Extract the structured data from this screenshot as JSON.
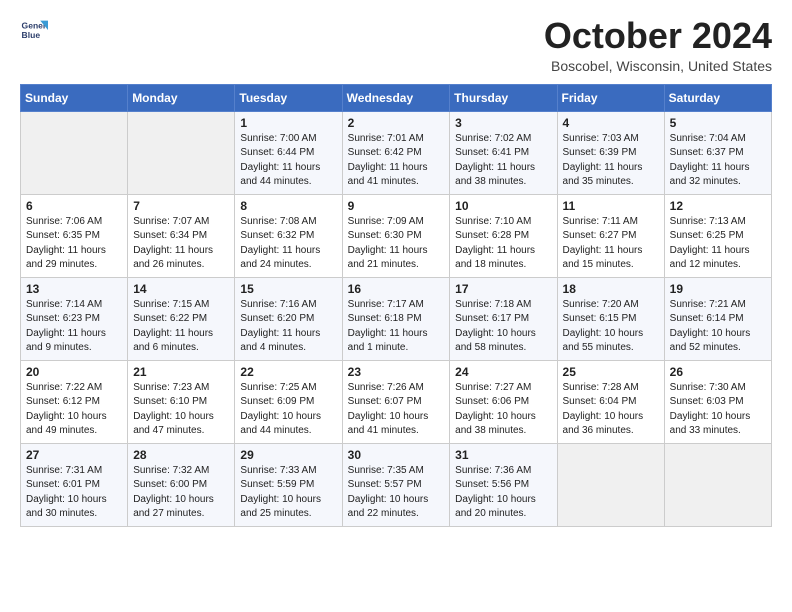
{
  "header": {
    "logo_line1": "General",
    "logo_line2": "Blue",
    "month": "October 2024",
    "location": "Boscobel, Wisconsin, United States"
  },
  "columns": [
    "Sunday",
    "Monday",
    "Tuesday",
    "Wednesday",
    "Thursday",
    "Friday",
    "Saturday"
  ],
  "weeks": [
    [
      {
        "day": "",
        "sunrise": "",
        "sunset": "",
        "daylight": ""
      },
      {
        "day": "",
        "sunrise": "",
        "sunset": "",
        "daylight": ""
      },
      {
        "day": "1",
        "sunrise": "Sunrise: 7:00 AM",
        "sunset": "Sunset: 6:44 PM",
        "daylight": "Daylight: 11 hours and 44 minutes."
      },
      {
        "day": "2",
        "sunrise": "Sunrise: 7:01 AM",
        "sunset": "Sunset: 6:42 PM",
        "daylight": "Daylight: 11 hours and 41 minutes."
      },
      {
        "day": "3",
        "sunrise": "Sunrise: 7:02 AM",
        "sunset": "Sunset: 6:41 PM",
        "daylight": "Daylight: 11 hours and 38 minutes."
      },
      {
        "day": "4",
        "sunrise": "Sunrise: 7:03 AM",
        "sunset": "Sunset: 6:39 PM",
        "daylight": "Daylight: 11 hours and 35 minutes."
      },
      {
        "day": "5",
        "sunrise": "Sunrise: 7:04 AM",
        "sunset": "Sunset: 6:37 PM",
        "daylight": "Daylight: 11 hours and 32 minutes."
      }
    ],
    [
      {
        "day": "6",
        "sunrise": "Sunrise: 7:06 AM",
        "sunset": "Sunset: 6:35 PM",
        "daylight": "Daylight: 11 hours and 29 minutes."
      },
      {
        "day": "7",
        "sunrise": "Sunrise: 7:07 AM",
        "sunset": "Sunset: 6:34 PM",
        "daylight": "Daylight: 11 hours and 26 minutes."
      },
      {
        "day": "8",
        "sunrise": "Sunrise: 7:08 AM",
        "sunset": "Sunset: 6:32 PM",
        "daylight": "Daylight: 11 hours and 24 minutes."
      },
      {
        "day": "9",
        "sunrise": "Sunrise: 7:09 AM",
        "sunset": "Sunset: 6:30 PM",
        "daylight": "Daylight: 11 hours and 21 minutes."
      },
      {
        "day": "10",
        "sunrise": "Sunrise: 7:10 AM",
        "sunset": "Sunset: 6:28 PM",
        "daylight": "Daylight: 11 hours and 18 minutes."
      },
      {
        "day": "11",
        "sunrise": "Sunrise: 7:11 AM",
        "sunset": "Sunset: 6:27 PM",
        "daylight": "Daylight: 11 hours and 15 minutes."
      },
      {
        "day": "12",
        "sunrise": "Sunrise: 7:13 AM",
        "sunset": "Sunset: 6:25 PM",
        "daylight": "Daylight: 11 hours and 12 minutes."
      }
    ],
    [
      {
        "day": "13",
        "sunrise": "Sunrise: 7:14 AM",
        "sunset": "Sunset: 6:23 PM",
        "daylight": "Daylight: 11 hours and 9 minutes."
      },
      {
        "day": "14",
        "sunrise": "Sunrise: 7:15 AM",
        "sunset": "Sunset: 6:22 PM",
        "daylight": "Daylight: 11 hours and 6 minutes."
      },
      {
        "day": "15",
        "sunrise": "Sunrise: 7:16 AM",
        "sunset": "Sunset: 6:20 PM",
        "daylight": "Daylight: 11 hours and 4 minutes."
      },
      {
        "day": "16",
        "sunrise": "Sunrise: 7:17 AM",
        "sunset": "Sunset: 6:18 PM",
        "daylight": "Daylight: 11 hours and 1 minute."
      },
      {
        "day": "17",
        "sunrise": "Sunrise: 7:18 AM",
        "sunset": "Sunset: 6:17 PM",
        "daylight": "Daylight: 10 hours and 58 minutes."
      },
      {
        "day": "18",
        "sunrise": "Sunrise: 7:20 AM",
        "sunset": "Sunset: 6:15 PM",
        "daylight": "Daylight: 10 hours and 55 minutes."
      },
      {
        "day": "19",
        "sunrise": "Sunrise: 7:21 AM",
        "sunset": "Sunset: 6:14 PM",
        "daylight": "Daylight: 10 hours and 52 minutes."
      }
    ],
    [
      {
        "day": "20",
        "sunrise": "Sunrise: 7:22 AM",
        "sunset": "Sunset: 6:12 PM",
        "daylight": "Daylight: 10 hours and 49 minutes."
      },
      {
        "day": "21",
        "sunrise": "Sunrise: 7:23 AM",
        "sunset": "Sunset: 6:10 PM",
        "daylight": "Daylight: 10 hours and 47 minutes."
      },
      {
        "day": "22",
        "sunrise": "Sunrise: 7:25 AM",
        "sunset": "Sunset: 6:09 PM",
        "daylight": "Daylight: 10 hours and 44 minutes."
      },
      {
        "day": "23",
        "sunrise": "Sunrise: 7:26 AM",
        "sunset": "Sunset: 6:07 PM",
        "daylight": "Daylight: 10 hours and 41 minutes."
      },
      {
        "day": "24",
        "sunrise": "Sunrise: 7:27 AM",
        "sunset": "Sunset: 6:06 PM",
        "daylight": "Daylight: 10 hours and 38 minutes."
      },
      {
        "day": "25",
        "sunrise": "Sunrise: 7:28 AM",
        "sunset": "Sunset: 6:04 PM",
        "daylight": "Daylight: 10 hours and 36 minutes."
      },
      {
        "day": "26",
        "sunrise": "Sunrise: 7:30 AM",
        "sunset": "Sunset: 6:03 PM",
        "daylight": "Daylight: 10 hours and 33 minutes."
      }
    ],
    [
      {
        "day": "27",
        "sunrise": "Sunrise: 7:31 AM",
        "sunset": "Sunset: 6:01 PM",
        "daylight": "Daylight: 10 hours and 30 minutes."
      },
      {
        "day": "28",
        "sunrise": "Sunrise: 7:32 AM",
        "sunset": "Sunset: 6:00 PM",
        "daylight": "Daylight: 10 hours and 27 minutes."
      },
      {
        "day": "29",
        "sunrise": "Sunrise: 7:33 AM",
        "sunset": "Sunset: 5:59 PM",
        "daylight": "Daylight: 10 hours and 25 minutes."
      },
      {
        "day": "30",
        "sunrise": "Sunrise: 7:35 AM",
        "sunset": "Sunset: 5:57 PM",
        "daylight": "Daylight: 10 hours and 22 minutes."
      },
      {
        "day": "31",
        "sunrise": "Sunrise: 7:36 AM",
        "sunset": "Sunset: 5:56 PM",
        "daylight": "Daylight: 10 hours and 20 minutes."
      },
      {
        "day": "",
        "sunrise": "",
        "sunset": "",
        "daylight": ""
      },
      {
        "day": "",
        "sunrise": "",
        "sunset": "",
        "daylight": ""
      }
    ]
  ]
}
